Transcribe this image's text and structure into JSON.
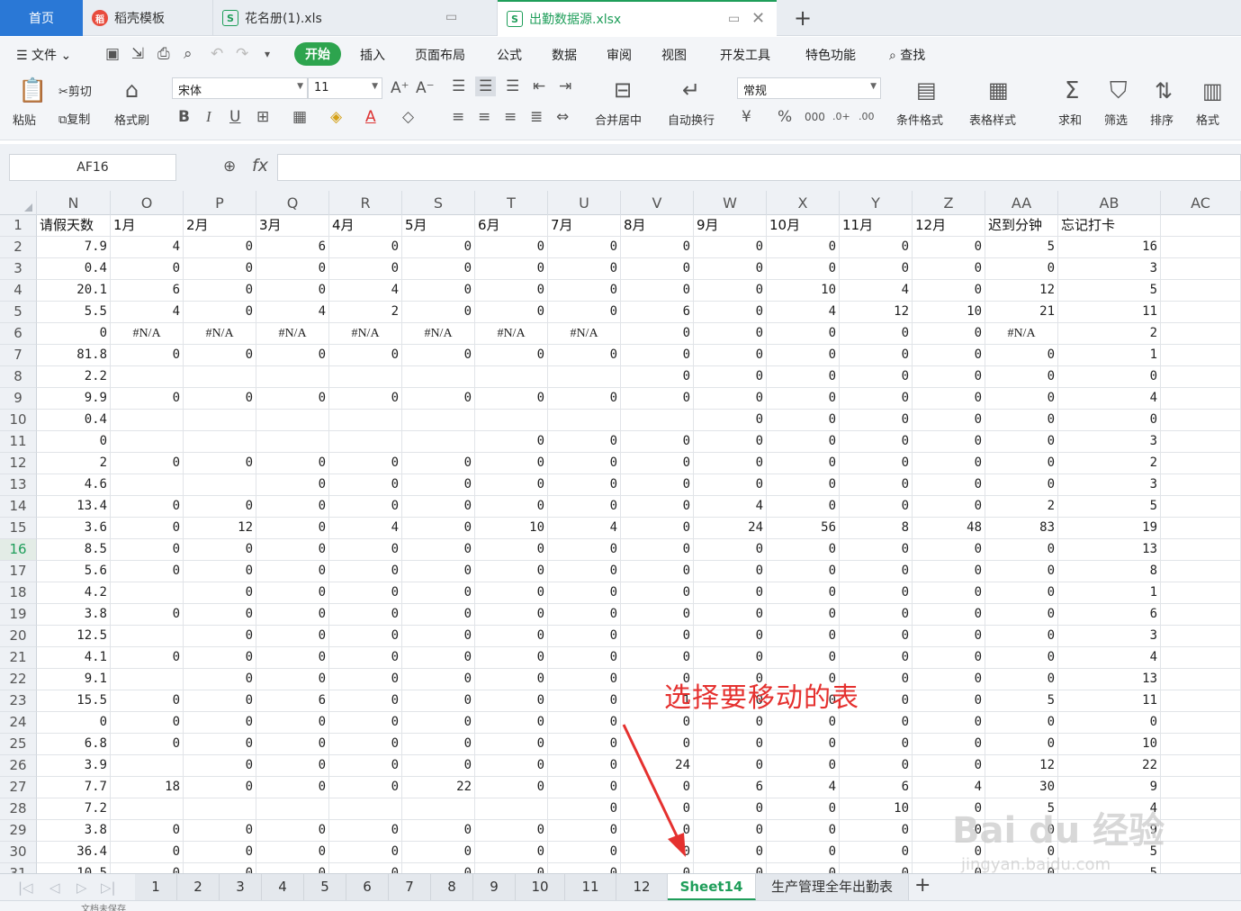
{
  "tabs": {
    "home": "首页",
    "t1": "稻壳模板",
    "t2": "花名册(1).xls",
    "t3": "出勤数据源.xlsx"
  },
  "menu": {
    "file": "文件",
    "items": [
      "开始",
      "插入",
      "页面布局",
      "公式",
      "数据",
      "审阅",
      "视图",
      "开发工具",
      "特色功能",
      "查找"
    ]
  },
  "ribbon": {
    "paste": "粘贴",
    "cut": "剪切",
    "copy": "复制",
    "format_painter": "格式刷",
    "font": "宋体",
    "size": "11",
    "merge": "合并居中",
    "wrap": "自动换行",
    "numfmt": "常规",
    "cond": "条件格式",
    "table_style": "表格样式",
    "sum": "求和",
    "filter": "筛选",
    "sort": "排序",
    "format": "格式"
  },
  "formula_bar": {
    "name_box": "AF16",
    "fx": "fx",
    "content": ""
  },
  "columns": [
    "N",
    "O",
    "P",
    "Q",
    "R",
    "S",
    "T",
    "U",
    "V",
    "W",
    "X",
    "Y",
    "Z",
    "AA",
    "AB",
    "AC"
  ],
  "header_row": [
    "请假天数",
    "1月",
    "2月",
    "3月",
    "4月",
    "5月",
    "6月",
    "7月",
    "8月",
    "9月",
    "10月",
    "11月",
    "12月",
    "迟到分钟",
    "忘记打卡",
    ""
  ],
  "rows": [
    [
      "7.9",
      "4",
      "0",
      "6",
      "0",
      "0",
      "0",
      "0",
      "0",
      "0",
      "0",
      "0",
      "0",
      "5",
      "16"
    ],
    [
      "0.4",
      "0",
      "0",
      "0",
      "0",
      "0",
      "0",
      "0",
      "0",
      "0",
      "0",
      "0",
      "0",
      "0",
      "3"
    ],
    [
      "20.1",
      "6",
      "0",
      "0",
      "4",
      "0",
      "0",
      "0",
      "0",
      "0",
      "10",
      "4",
      "0",
      "12",
      "5"
    ],
    [
      "5.5",
      "4",
      "0",
      "4",
      "2",
      "0",
      "0",
      "0",
      "6",
      "0",
      "4",
      "12",
      "10",
      "21",
      "11"
    ],
    [
      "0",
      "#N/A",
      "#N/A",
      "#N/A",
      "#N/A",
      "#N/A",
      "#N/A",
      "#N/A",
      "0",
      "0",
      "0",
      "0",
      "0",
      "#N/A",
      "2"
    ],
    [
      "81.8",
      "0",
      "0",
      "0",
      "0",
      "0",
      "0",
      "0",
      "0",
      "0",
      "0",
      "0",
      "0",
      "0",
      "1"
    ],
    [
      "2.2",
      "",
      "",
      "",
      "",
      "",
      "",
      "",
      "0",
      "0",
      "0",
      "0",
      "0",
      "0",
      "0"
    ],
    [
      "9.9",
      "0",
      "0",
      "0",
      "0",
      "0",
      "0",
      "0",
      "0",
      "0",
      "0",
      "0",
      "0",
      "0",
      "4"
    ],
    [
      "0.4",
      "",
      "",
      "",
      "",
      "",
      "",
      "",
      "",
      "0",
      "0",
      "0",
      "0",
      "0",
      "0"
    ],
    [
      "0",
      "",
      "",
      "",
      "",
      "",
      "0",
      "0",
      "0",
      "0",
      "0",
      "0",
      "0",
      "0",
      "3"
    ],
    [
      "2",
      "0",
      "0",
      "0",
      "0",
      "0",
      "0",
      "0",
      "0",
      "0",
      "0",
      "0",
      "0",
      "0",
      "2"
    ],
    [
      "4.6",
      "",
      "",
      "0",
      "0",
      "0",
      "0",
      "0",
      "0",
      "0",
      "0",
      "0",
      "0",
      "0",
      "3"
    ],
    [
      "13.4",
      "0",
      "0",
      "0",
      "0",
      "0",
      "0",
      "0",
      "0",
      "4",
      "0",
      "0",
      "0",
      "2",
      "5"
    ],
    [
      "3.6",
      "0",
      "12",
      "0",
      "4",
      "0",
      "10",
      "4",
      "0",
      "24",
      "56",
      "8",
      "48",
      "83",
      "19"
    ],
    [
      "8.5",
      "0",
      "0",
      "0",
      "0",
      "0",
      "0",
      "0",
      "0",
      "0",
      "0",
      "0",
      "0",
      "0",
      "13"
    ],
    [
      "5.6",
      "0",
      "0",
      "0",
      "0",
      "0",
      "0",
      "0",
      "0",
      "0",
      "0",
      "0",
      "0",
      "0",
      "8"
    ],
    [
      "4.2",
      "",
      "0",
      "0",
      "0",
      "0",
      "0",
      "0",
      "0",
      "0",
      "0",
      "0",
      "0",
      "0",
      "1"
    ],
    [
      "3.8",
      "0",
      "0",
      "0",
      "0",
      "0",
      "0",
      "0",
      "0",
      "0",
      "0",
      "0",
      "0",
      "0",
      "6"
    ],
    [
      "12.5",
      "",
      "0",
      "0",
      "0",
      "0",
      "0",
      "0",
      "0",
      "0",
      "0",
      "0",
      "0",
      "0",
      "3"
    ],
    [
      "4.1",
      "0",
      "0",
      "0",
      "0",
      "0",
      "0",
      "0",
      "0",
      "0",
      "0",
      "0",
      "0",
      "0",
      "4"
    ],
    [
      "9.1",
      "",
      "0",
      "0",
      "0",
      "0",
      "0",
      "0",
      "0",
      "0",
      "0",
      "0",
      "0",
      "0",
      "13"
    ],
    [
      "15.5",
      "0",
      "0",
      "6",
      "0",
      "0",
      "0",
      "0",
      "1",
      "0",
      "0",
      "0",
      "0",
      "5",
      "11"
    ],
    [
      "0",
      "0",
      "0",
      "0",
      "0",
      "0",
      "0",
      "0",
      "0",
      "0",
      "0",
      "0",
      "0",
      "0",
      "0"
    ],
    [
      "6.8",
      "0",
      "0",
      "0",
      "0",
      "0",
      "0",
      "0",
      "0",
      "0",
      "0",
      "0",
      "0",
      "0",
      "10"
    ],
    [
      "3.9",
      "",
      "0",
      "0",
      "0",
      "0",
      "0",
      "0",
      "24",
      "0",
      "0",
      "0",
      "0",
      "12",
      "22"
    ],
    [
      "7.7",
      "18",
      "0",
      "0",
      "0",
      "22",
      "0",
      "0",
      "0",
      "6",
      "4",
      "6",
      "4",
      "30",
      "9"
    ],
    [
      "7.2",
      "",
      "",
      "",
      "",
      "",
      "",
      "0",
      "0",
      "0",
      "0",
      "10",
      "0",
      "5",
      "4"
    ],
    [
      "3.8",
      "0",
      "0",
      "0",
      "0",
      "0",
      "0",
      "0",
      "0",
      "0",
      "0",
      "0",
      "0",
      "0",
      "9"
    ],
    [
      "36.4",
      "0",
      "0",
      "0",
      "0",
      "0",
      "0",
      "0",
      "0",
      "0",
      "0",
      "0",
      "0",
      "0",
      "5"
    ],
    [
      "10.5",
      "0",
      "0",
      "0",
      "0",
      "0",
      "0",
      "0",
      "0",
      "0",
      "0",
      "0",
      "0",
      "0",
      "5"
    ]
  ],
  "annotation": "选择要移动的表",
  "watermark": "Bai du 经验",
  "watermark_url": "jingyan.baidu.com",
  "sheets": [
    "1",
    "2",
    "3",
    "4",
    "5",
    "6",
    "7",
    "8",
    "9",
    "10",
    "11",
    "12",
    "Sheet14",
    "生产管理全年出勤表"
  ],
  "active_sheet": "Sheet14",
  "status_text": "文档未保存"
}
